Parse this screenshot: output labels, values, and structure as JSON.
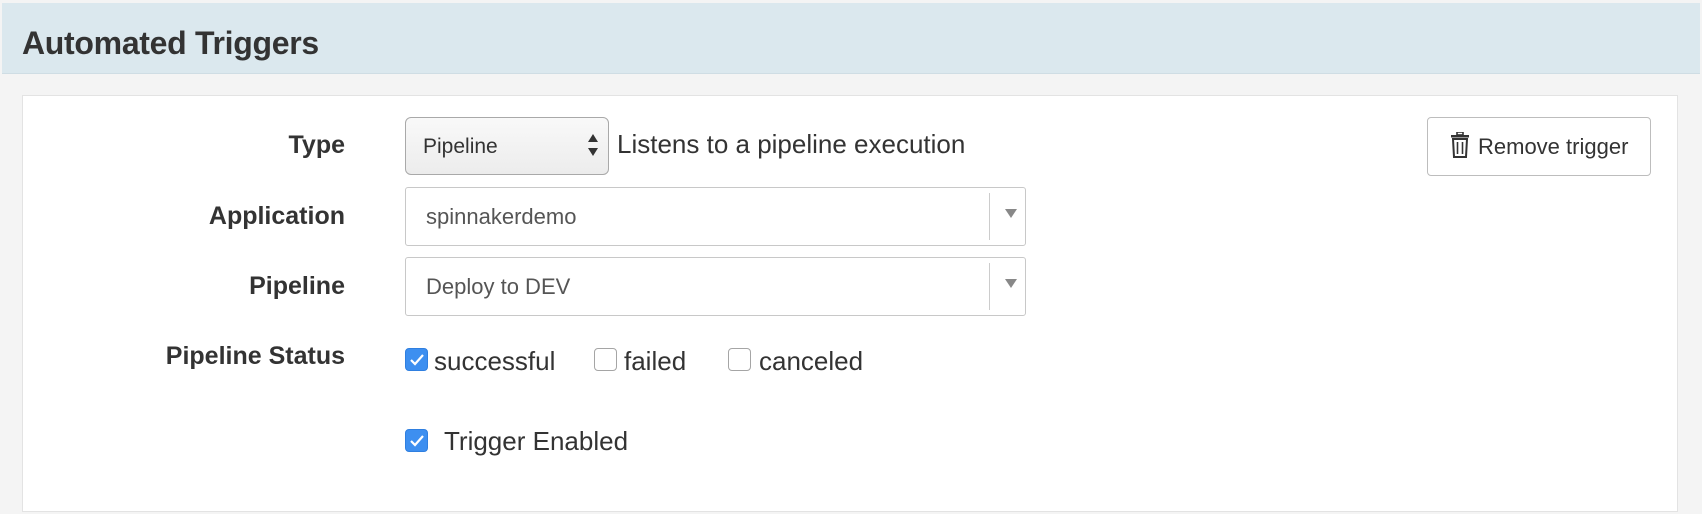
{
  "header": {
    "title": "Automated Triggers"
  },
  "form": {
    "type": {
      "label": "Type",
      "selected": "Pipeline",
      "description": "Listens to a pipeline execution"
    },
    "application": {
      "label": "Application",
      "value": "spinnakerdemo"
    },
    "pipeline": {
      "label": "Pipeline",
      "value": "Deploy to DEV"
    },
    "pipeline_status": {
      "label": "Pipeline Status",
      "options": [
        {
          "label": "successful",
          "checked": true
        },
        {
          "label": "failed",
          "checked": false
        },
        {
          "label": "canceled",
          "checked": false
        }
      ]
    },
    "trigger_enabled": {
      "label": "Trigger Enabled",
      "checked": true
    }
  },
  "actions": {
    "remove_label": "Remove trigger"
  },
  "icons": {
    "remove": "trash-icon",
    "check": "check-icon",
    "select_arrows": "sort-arrows-icon",
    "dropdown": "caret-down-icon"
  },
  "colors": {
    "header_bg": "#dbe8ee",
    "checkbox_checked": "#3d8ff0",
    "panel_bg": "#ffffff"
  }
}
